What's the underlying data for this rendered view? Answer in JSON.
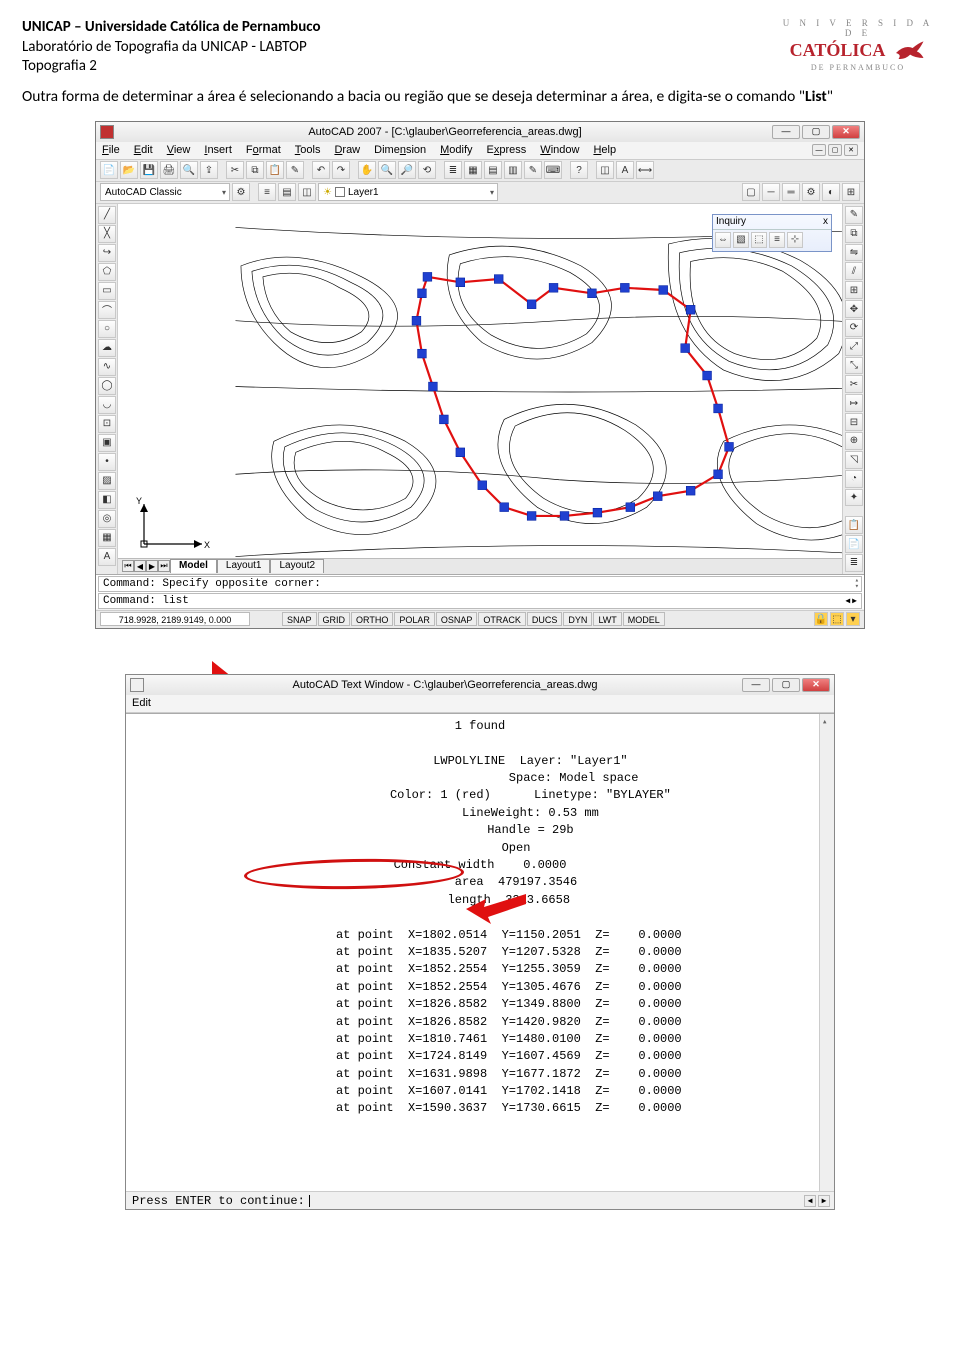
{
  "header": {
    "line1": "UNICAP – Universidade Católica de Pernambuco",
    "line2": "Laboratório de Topografia da UNICAP - LABTOP",
    "line3": "Topografia 2"
  },
  "logo": {
    "top": "U N I V E R S I D A D E",
    "main": "CATÓLICA",
    "bottom": "DE PERNAMBUCO"
  },
  "body": {
    "paragraph_pre": "Outra forma de determinar a área é selecionando a bacia ou região que se deseja determinar a área, e digita-se o comando \"",
    "paragraph_bold": "List",
    "paragraph_post": "\""
  },
  "autocad": {
    "title": "AutoCAD 2007 - [C:\\glauber\\Georreferencia_areas.dwg]",
    "menus": {
      "file": "File",
      "edit": "Edit",
      "view": "View",
      "insert": "Insert",
      "format": "Format",
      "tools": "Tools",
      "draw": "Draw",
      "dimension": "Dimension",
      "modify": "Modify",
      "express": "Express",
      "window": "Window",
      "help": "Help"
    },
    "workspace": "AutoCAD Classic",
    "layer": "Layer1",
    "inquiry": {
      "title": "Inquiry",
      "close": "x"
    },
    "tabs": {
      "model": "Model",
      "layout1": "Layout1",
      "layout2": "Layout2"
    },
    "cmd1": "Command: Specify opposite corner:",
    "cmd2": "Command: list",
    "coords": "718.9928, 2189.9149, 0.000",
    "status": {
      "snap": "SNAP",
      "grid": "GRID",
      "ortho": "ORTHO",
      "polar": "POLAR",
      "osnap": "OSNAP",
      "otrack": "OTRACK",
      "ducs": "DUCS",
      "dyn": "DYN",
      "lwt": "LWT",
      "model": "MODEL"
    }
  },
  "textwin": {
    "title": "AutoCAD Text Window - C:\\glauber\\Georreferencia_areas.dwg",
    "edit": "Edit",
    "found": "1 found",
    "obj": {
      "line1": "              LWPOLYLINE  Layer: \"Layer1\"",
      "line2": "                          Space: Model space",
      "line3": "              Color: 1 (red)      Linetype: \"BYLAYER\"",
      "line4": "              LineWeight: 0.53 mm",
      "line5": "              Handle = 29b",
      "line6": "          Open",
      "line7": "Constant width    0.0000",
      "line8": "          area  479197.3546",
      "line9": "        length  3213.6658"
    },
    "points": [
      {
        "x": "1802.0514",
        "y": "1150.2051",
        "z": "0.0000"
      },
      {
        "x": "1835.5207",
        "y": "1207.5328",
        "z": "0.0000"
      },
      {
        "x": "1852.2554",
        "y": "1255.3059",
        "z": "0.0000"
      },
      {
        "x": "1852.2554",
        "y": "1305.4676",
        "z": "0.0000"
      },
      {
        "x": "1826.8582",
        "y": "1349.8800",
        "z": "0.0000"
      },
      {
        "x": "1826.8582",
        "y": "1420.9820",
        "z": "0.0000"
      },
      {
        "x": "1810.7461",
        "y": "1480.0100",
        "z": "0.0000"
      },
      {
        "x": "1724.8149",
        "y": "1607.4569",
        "z": "0.0000"
      },
      {
        "x": "1631.9898",
        "y": "1677.1872",
        "z": "0.0000"
      },
      {
        "x": "1607.0141",
        "y": "1702.1418",
        "z": "0.0000"
      },
      {
        "x": "1590.3637",
        "y": "1730.6615",
        "z": "0.0000"
      }
    ],
    "footer": "Press ENTER to continue:"
  }
}
